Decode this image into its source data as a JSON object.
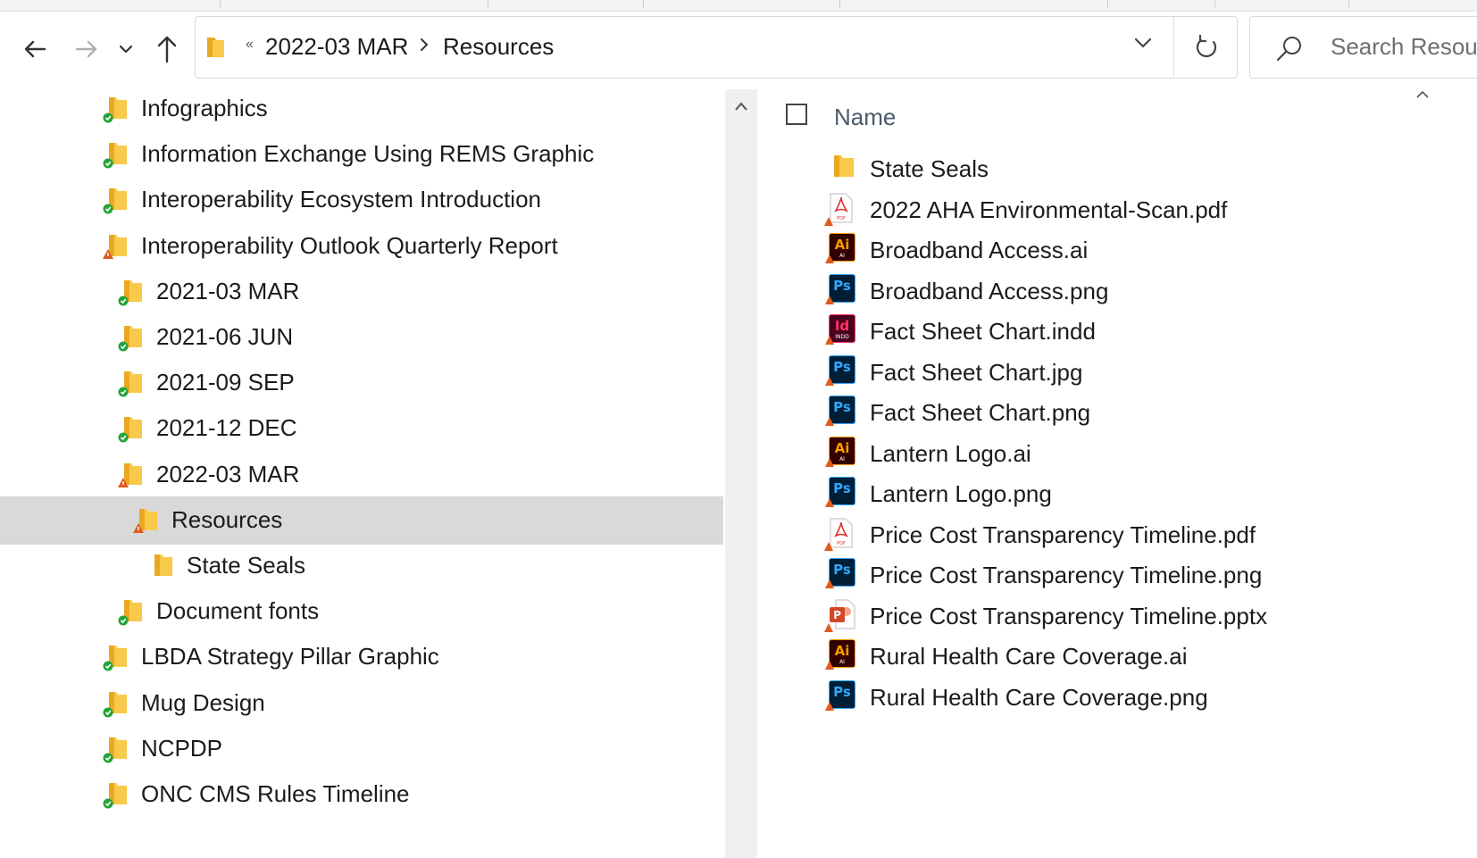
{
  "nav": {
    "back_icon": "arrow-left-icon",
    "forward_icon": "arrow-right-icon",
    "recent_icon": "chevron-down-icon",
    "up_icon": "arrow-up-icon"
  },
  "address": {
    "overflow_marker": "«",
    "crumbs": [
      "2022-03 MAR",
      "Resources"
    ],
    "refresh_icon": "refresh-icon"
  },
  "search": {
    "placeholder": "Search Resources"
  },
  "tree": {
    "items": [
      {
        "label": "Infographics",
        "status": "synced",
        "level": 0
      },
      {
        "label": "Information Exchange Using REMS Graphic",
        "status": "synced",
        "level": 0
      },
      {
        "label": "Interoperability Ecosystem Introduction",
        "status": "synced",
        "level": 0
      },
      {
        "label": "Interoperability Outlook Quarterly Report",
        "status": "warning",
        "level": 0
      },
      {
        "label": "2021-03 MAR",
        "status": "synced",
        "level": 1
      },
      {
        "label": "2021-06 JUN",
        "status": "synced",
        "level": 1
      },
      {
        "label": "2021-09 SEP",
        "status": "synced",
        "level": 1
      },
      {
        "label": "2021-12 DEC",
        "status": "synced",
        "level": 1
      },
      {
        "label": "2022-03 MAR",
        "status": "warning",
        "level": 1
      },
      {
        "label": "Resources",
        "status": "warning",
        "level": 2,
        "selected": true
      },
      {
        "label": "State Seals",
        "status": "none",
        "level": 3
      },
      {
        "label": "Document fonts",
        "status": "synced",
        "level": 1
      },
      {
        "label": "LBDA Strategy Pillar Graphic",
        "status": "synced",
        "level": 0
      },
      {
        "label": "Mug Design",
        "status": "synced",
        "level": 0
      },
      {
        "label": "NCPDP",
        "status": "synced",
        "level": 0
      },
      {
        "label": "ONC CMS Rules Timeline",
        "status": "synced",
        "level": 0
      }
    ]
  },
  "list": {
    "column_name": "Name",
    "files": [
      {
        "name": "State Seals",
        "type": "folder"
      },
      {
        "name": "2022 AHA Environmental-Scan.pdf",
        "type": "pdf"
      },
      {
        "name": "Broadband Access.ai",
        "type": "ai"
      },
      {
        "name": "Broadband Access.png",
        "type": "ps"
      },
      {
        "name": "Fact Sheet Chart.indd",
        "type": "id"
      },
      {
        "name": "Fact Sheet Chart.jpg",
        "type": "ps"
      },
      {
        "name": "Fact Sheet Chart.png",
        "type": "ps"
      },
      {
        "name": "Lantern Logo.ai",
        "type": "ai"
      },
      {
        "name": "Lantern Logo.png",
        "type": "ps"
      },
      {
        "name": "Price Cost Transparency Timeline.pdf",
        "type": "pdf"
      },
      {
        "name": "Price Cost Transparency Timeline.png",
        "type": "ps"
      },
      {
        "name": "Price Cost Transparency Timeline.pptx",
        "type": "pptx"
      },
      {
        "name": "Rural Health Care Coverage.ai",
        "type": "ai"
      },
      {
        "name": "Rural Health Care Coverage.png",
        "type": "ps"
      }
    ]
  },
  "colors": {
    "folder": "#f9c94a",
    "folder_dark": "#e8a920",
    "synced": "#23a33a",
    "warning": "#e05a1e",
    "selected_bg": "#d9d9d9"
  }
}
